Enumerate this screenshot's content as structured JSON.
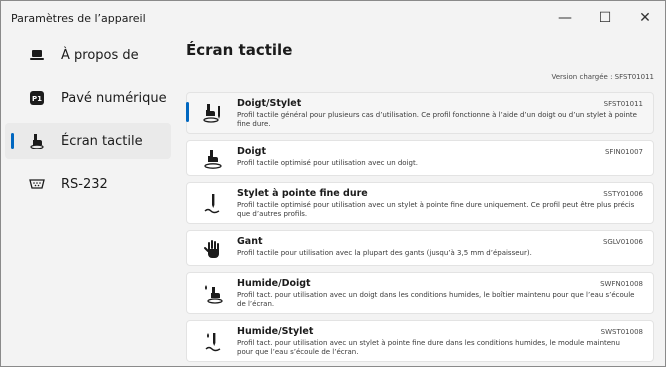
{
  "window": {
    "title": "Paramètres de l’appareil",
    "controls": {
      "minimize": "—",
      "maximize": "☐",
      "close": "✕"
    }
  },
  "sidebar": {
    "items": [
      {
        "label": "À propos de",
        "icon": "laptop-icon",
        "selected": false
      },
      {
        "label": "Pavé numérique",
        "icon": "p1-keypad-icon",
        "selected": false
      },
      {
        "label": "Écran tactile",
        "icon": "touch-hand-icon",
        "selected": true
      },
      {
        "label": "RS-232",
        "icon": "serial-port-icon",
        "selected": false
      }
    ]
  },
  "main": {
    "title": "Écran tactile",
    "version_text": "Version chargée :  SFST01011",
    "profiles": [
      {
        "name": "Doigt/Stylet",
        "code": "SFST01011",
        "description": "Profil tactile général pour plusieurs cas d’utilisation. Ce profil fonctionne à l’aide d’un doigt ou d’un stylet à pointe fine dure.",
        "icon": "finger-stylus-icon",
        "selected": true
      },
      {
        "name": "Doigt",
        "code": "SFIN01007",
        "description": "Profil tactile optimisé pour utilisation avec un doigt.",
        "icon": "finger-touch-icon",
        "selected": false
      },
      {
        "name": "Stylet à pointe fine dure",
        "code": "SSTY01006",
        "description": "Profil tactile optimisé pour utilisation avec un stylet à pointe fine dure uniquement. Ce profil peut être plus précis que d’autres profils.",
        "icon": "stylus-icon",
        "selected": false
      },
      {
        "name": "Gant",
        "code": "SGLV01006",
        "description": "Profil tactile pour utilisation avec la plupart des gants (jusqu’à 3,5 mm d’épaisseur).",
        "icon": "glove-icon",
        "selected": false
      },
      {
        "name": "Humide/Doigt",
        "code": "SWFN01008",
        "description": "Profil tact. pour utilisation avec un doigt dans les conditions humides, le boîtier maintenu pour que l’eau s’écoule de l’écran.",
        "icon": "wet-finger-icon",
        "selected": false
      },
      {
        "name": "Humide/Stylet",
        "code": "SWST01008",
        "description": "Profil tact. pour utilisation avec un stylet à pointe fine dure dans les conditions humides, le module maintenu pour que l’eau s’écoule de l’écran.",
        "icon": "wet-stylus-icon",
        "selected": false
      }
    ]
  },
  "colors": {
    "accent": "#0067c0",
    "window_bg": "#f3f3f3",
    "card_bg": "#ffffff"
  }
}
